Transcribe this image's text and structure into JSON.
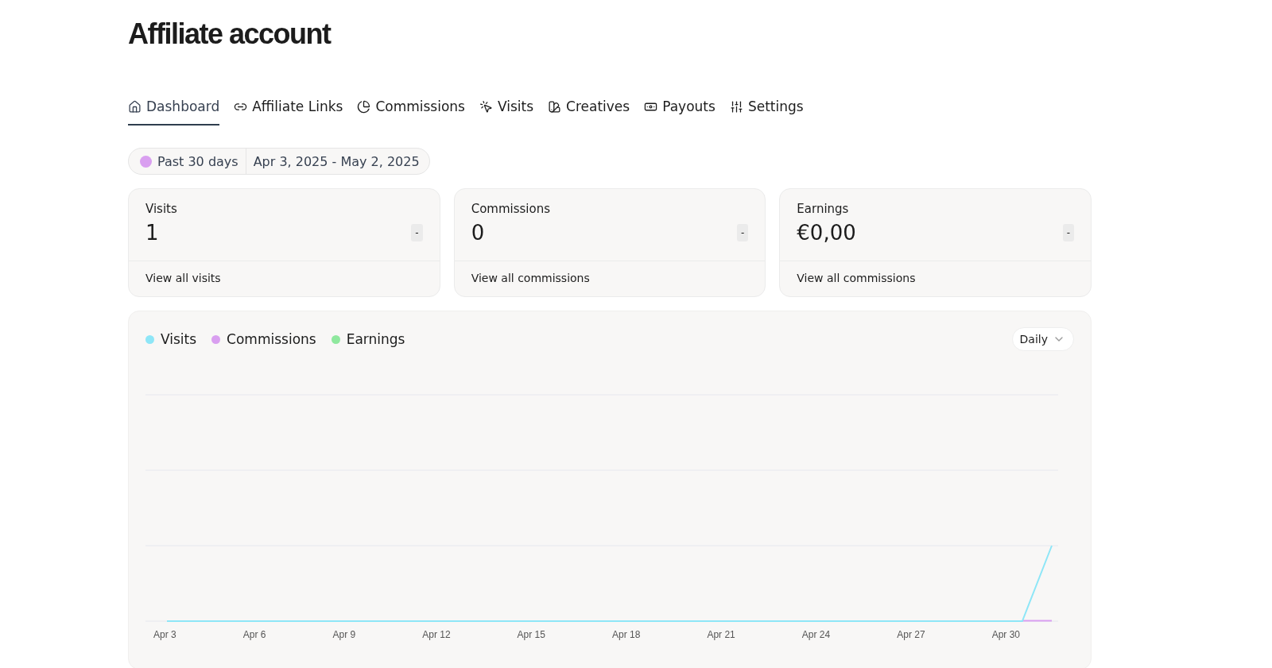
{
  "page_title": "Affiliate account",
  "tabs": [
    {
      "label": "Dashboard",
      "selected": true
    },
    {
      "label": "Affiliate Links",
      "selected": false
    },
    {
      "label": "Commissions",
      "selected": false
    },
    {
      "label": "Visits",
      "selected": false
    },
    {
      "label": "Creatives",
      "selected": false
    },
    {
      "label": "Payouts",
      "selected": false
    },
    {
      "label": "Settings",
      "selected": false
    }
  ],
  "date_range": {
    "preset": "Past 30 days",
    "range": "Apr 3, 2025 - May 2, 2025"
  },
  "stats": [
    {
      "label": "Visits",
      "value": "1",
      "change": "-",
      "link": "View all visits"
    },
    {
      "label": "Commissions",
      "value": "0",
      "change": "-",
      "link": "View all commissions"
    },
    {
      "label": "Earnings",
      "value": "€0,00",
      "change": "-",
      "link": "View all commissions"
    }
  ],
  "chart": {
    "legend": [
      {
        "label": "Visits",
        "color": "#8ee6f7"
      },
      {
        "label": "Commissions",
        "color": "#d99ff0"
      },
      {
        "label": "Earnings",
        "color": "#8fe89e"
      }
    ],
    "interval": "Daily",
    "x_labels": [
      "Apr 3",
      "Apr 6",
      "Apr 9",
      "Apr 12",
      "Apr 15",
      "Apr 18",
      "Apr 21",
      "Apr 24",
      "Apr 27",
      "Apr 30"
    ]
  }
}
